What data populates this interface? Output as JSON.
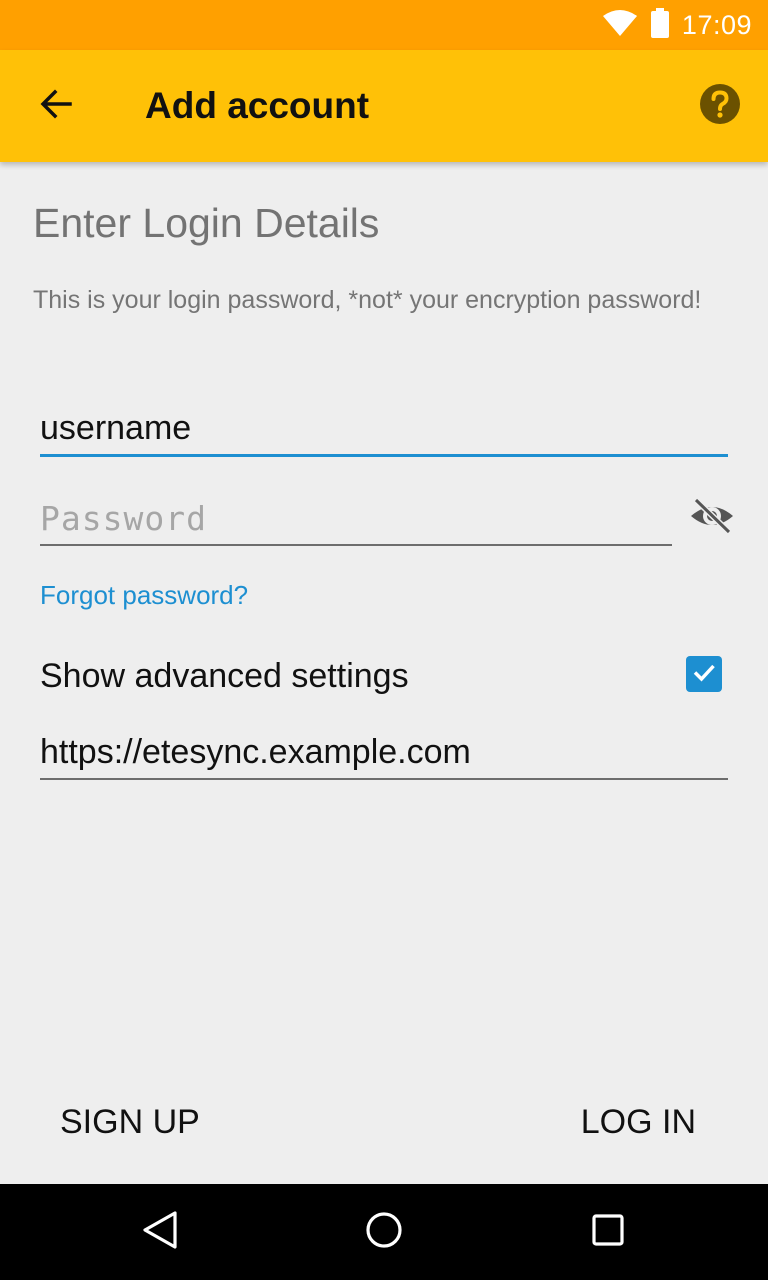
{
  "status_bar": {
    "time": "17:09",
    "icons": [
      "wifi-icon",
      "battery-icon"
    ],
    "background_color": "#ffa000"
  },
  "app_bar": {
    "title": "Add account",
    "back_icon": "arrow-back-icon",
    "help_icon": "help-circle-icon",
    "background_color": "#ffc107"
  },
  "form": {
    "heading": "Enter Login Details",
    "notice": "This is your login password, *not* your encryption password!",
    "username": {
      "value": "username",
      "placeholder": ""
    },
    "password": {
      "value": "",
      "placeholder": "Password",
      "visibility_icon": "visibility-off-icon"
    },
    "forgot_password_label": "Forgot password?",
    "advanced": {
      "label": "Show advanced settings",
      "checked": true
    },
    "server_url": {
      "value": "https://etesync.example.com",
      "placeholder": ""
    },
    "accent_color": "#1d8fd1"
  },
  "actions": {
    "sign_up_label": "SIGN UP",
    "log_in_label": "LOG IN"
  },
  "nav_bar": {
    "icons": [
      "nav-back-icon",
      "nav-home-icon",
      "nav-recents-icon"
    ]
  }
}
